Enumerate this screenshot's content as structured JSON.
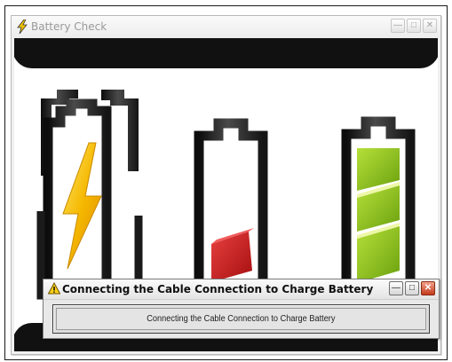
{
  "main_window": {
    "title": "Battery Check",
    "icon": "lightning-bolt-icon",
    "controls": [
      "minimize-icon",
      "maximize-icon",
      "close-icon"
    ]
  },
  "batteries": [
    {
      "name": "charging",
      "icon": "battery-charging-icon",
      "bolt_color": "#f5b800"
    },
    {
      "name": "low",
      "icon": "battery-low-icon",
      "fill_color": "#c51a1a",
      "level": 0.25
    },
    {
      "name": "full",
      "icon": "battery-full-icon",
      "fill_color": "#8ac21a",
      "level": 1.0
    }
  ],
  "dialog": {
    "title": "Connecting the Cable Connection to Charge Battery",
    "icon": "warning-icon",
    "message": "Connecting the Cable Connection to Charge Battery",
    "controls": [
      "minimize-icon",
      "maximize-icon",
      "close-icon"
    ]
  },
  "colors": {
    "window_title_text": "#9a9a9a",
    "dark_band": "#111111",
    "dialog_close": "#c23a1c"
  }
}
